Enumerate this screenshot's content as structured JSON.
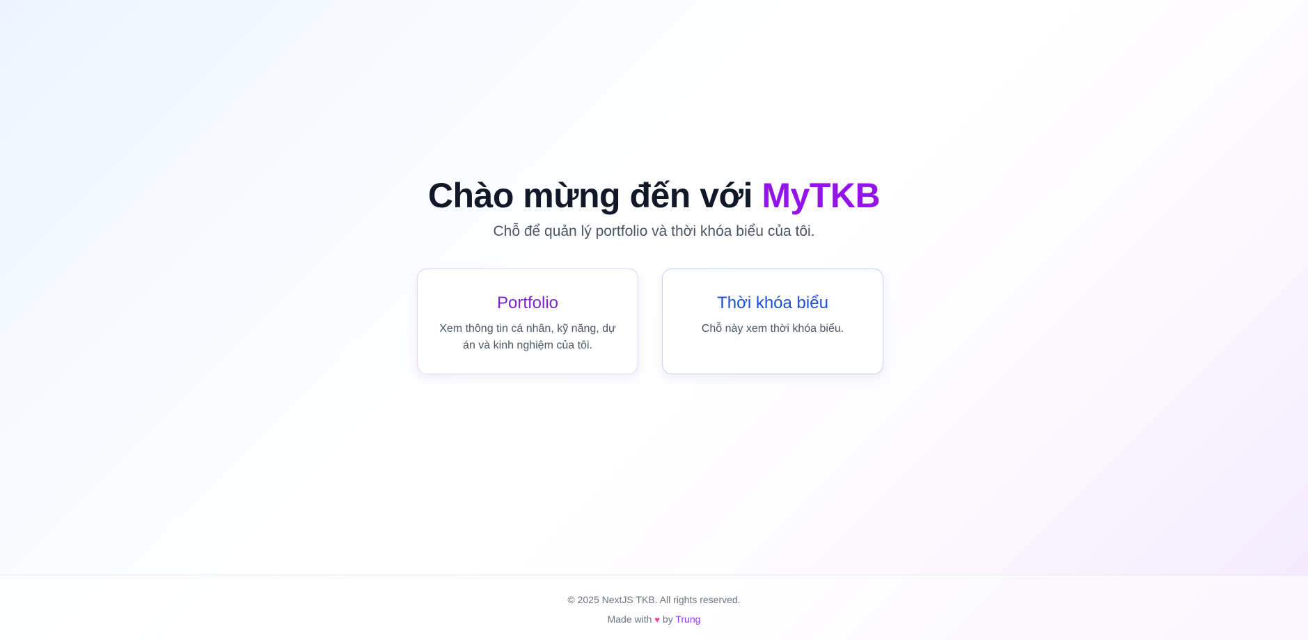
{
  "hero": {
    "title_prefix": "Chào mừng đến với ",
    "title_brand": "MyTKB",
    "subtitle": "Chỗ để quản lý portfolio và thời khóa biểu của tôi."
  },
  "cards": [
    {
      "title": "Portfolio",
      "description": "Xem thông tin cá nhân, kỹ năng, dự án và kinh nghiệm của tôi."
    },
    {
      "title": "Thời khóa biểu",
      "description": "Chỗ này xem thời khóa biểu."
    }
  ],
  "footer": {
    "copyright": "© 2025 NextJS TKB. All rights reserved.",
    "made_with": "Made with",
    "heart_icon": "♥",
    "by": "by",
    "author": "Trung"
  },
  "colors": {
    "brand": "#9314e8",
    "portfolio_accent": "#7e22ce",
    "tkb_accent": "#1d4ed8",
    "heart": "#ec4899"
  }
}
